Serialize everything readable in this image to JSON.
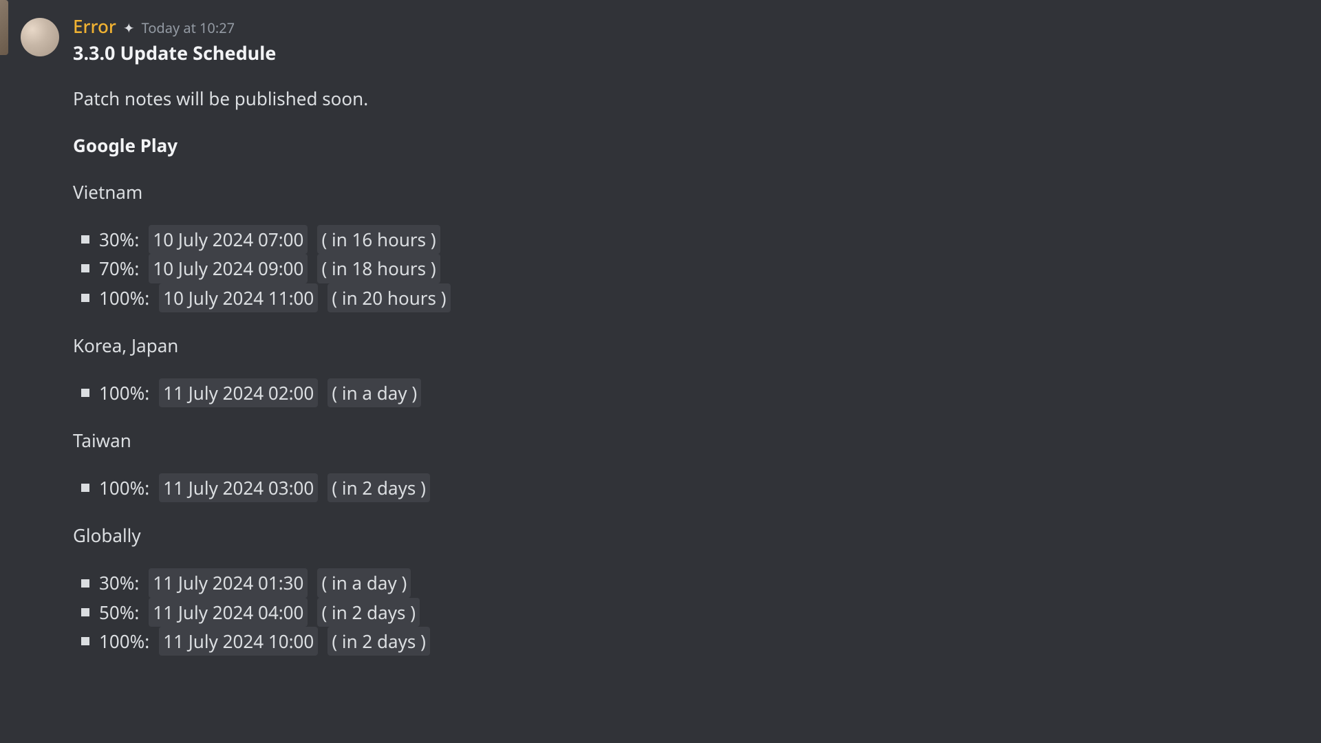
{
  "server_edge_visible": true,
  "message": {
    "username": "Error",
    "badge": "✦",
    "timestamp": "Today at 10:27",
    "title": "3.3.0 Update Schedule",
    "intro": "Patch notes will be published soon.",
    "store": "Google Play",
    "regions": [
      {
        "name": "Vietnam",
        "rollouts": [
          {
            "pct": "30%:",
            "ts": "10 July 2024 07:00",
            "rel": "( in 16 hours )"
          },
          {
            "pct": "70%:",
            "ts": "10 July 2024 09:00",
            "rel": "( in 18 hours )"
          },
          {
            "pct": "100%:",
            "ts": "10 July 2024 11:00",
            "rel": "( in 20 hours )"
          }
        ]
      },
      {
        "name": "Korea, Japan",
        "rollouts": [
          {
            "pct": "100%:",
            "ts": "11 July 2024 02:00",
            "rel": "( in a day )"
          }
        ]
      },
      {
        "name": "Taiwan",
        "rollouts": [
          {
            "pct": "100%:",
            "ts": "11 July 2024 03:00",
            "rel": "( in 2 days )"
          }
        ]
      },
      {
        "name": "Globally",
        "rollouts": [
          {
            "pct": "30%:",
            "ts": "11 July 2024 01:30",
            "rel": "( in a day )"
          },
          {
            "pct": "50%:",
            "ts": "11 July 2024 04:00",
            "rel": "( in 2 days )"
          },
          {
            "pct": "100%:",
            "ts": "11 July 2024 10:00",
            "rel": "( in 2 days )"
          }
        ]
      }
    ]
  }
}
